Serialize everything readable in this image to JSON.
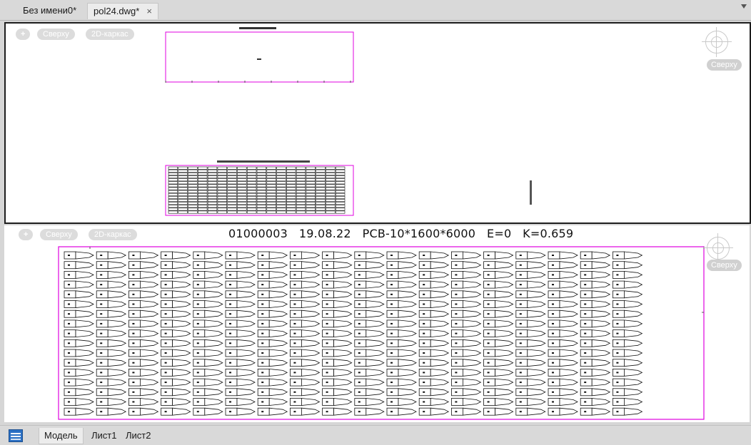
{
  "tabs": [
    {
      "label": "Без имени0*"
    },
    {
      "label": "pol24.dwg*",
      "close_icon": "×"
    }
  ],
  "viewport_top": {
    "controls": [
      "+",
      "Сверху",
      "2D-каркас"
    ],
    "view_cube_label": "Сверху",
    "drawing": {
      "upper_frame_color": "#e000e0",
      "lower_grid_rows": 16,
      "lower_grid_cols": 18
    }
  },
  "viewport_bottom": {
    "controls": [
      "+",
      "Сверху",
      "2D-каркас"
    ],
    "view_cube_label": "Сверху",
    "header_text": "01000003   19.08.22   PCB-10*1600*6000   E=0   K=0.659",
    "nest_rows": 17,
    "nest_cols": 18,
    "frame_color": "#e000e0"
  },
  "status_bar": {
    "icon": "layout-list-icon",
    "tabs": [
      "Модель",
      "Лист1",
      "Лист2"
    ],
    "active_tab": "Модель"
  }
}
